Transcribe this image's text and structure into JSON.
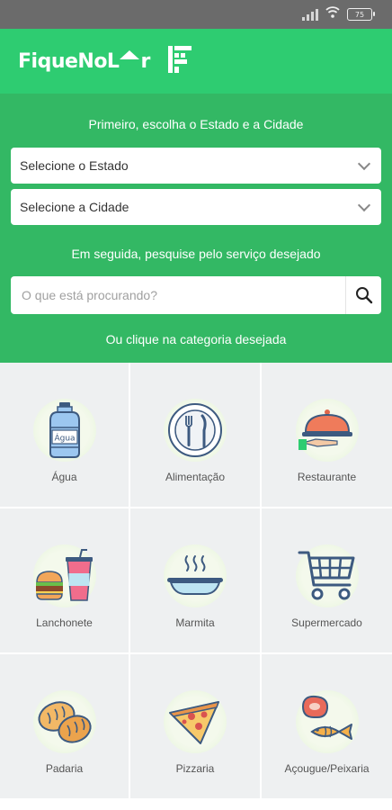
{
  "status_bar": {
    "battery": "75"
  },
  "header": {
    "logo_text_left": "FiqueNoL",
    "logo_text_right": "r"
  },
  "filters": {
    "intro": "Primeiro, escolha o Estado e a Cidade",
    "state_select": "Selecione o Estado",
    "city_select": "Selecione a Cidade",
    "search_intro": "Em seguida, pesquise pelo serviço desejado",
    "search_placeholder": "O que está procurando?",
    "category_intro": "Ou clique na categoria desejada"
  },
  "categories": [
    {
      "label": "Água",
      "icon": "water-jug-icon",
      "icon_text": "Água"
    },
    {
      "label": "Alimentação",
      "icon": "cutlery-icon"
    },
    {
      "label": "Restaurante",
      "icon": "cloche-icon"
    },
    {
      "label": "Lanchonete",
      "icon": "burger-drink-icon"
    },
    {
      "label": "Marmita",
      "icon": "bowl-icon"
    },
    {
      "label": "Supermercado",
      "icon": "cart-icon"
    },
    {
      "label": "Padaria",
      "icon": "bread-icon"
    },
    {
      "label": "Pizzaria",
      "icon": "pizza-icon"
    },
    {
      "label": "Açougue/Peixaria",
      "icon": "meat-fish-icon"
    }
  ],
  "colors": {
    "header": "#2ecc71",
    "hero": "#33b864",
    "grid_bg": "#eef0f1"
  }
}
